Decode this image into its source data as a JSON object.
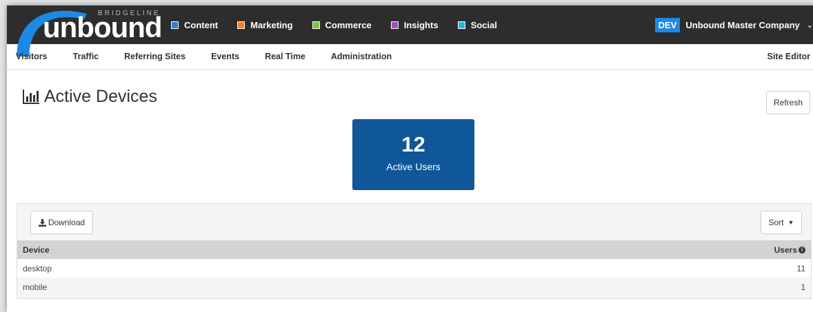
{
  "logo": {
    "word": "unbound",
    "tagline": "BRIDGELINE"
  },
  "modules": [
    {
      "label": "Content",
      "color": "#2f7fd6"
    },
    {
      "label": "Marketing",
      "color": "#f07f25"
    },
    {
      "label": "Commerce",
      "color": "#7ac143"
    },
    {
      "label": "Insights",
      "color": "#a04fb8"
    },
    {
      "label": "Social",
      "color": "#29b6d6"
    }
  ],
  "account": {
    "env_badge": "DEV",
    "company": "Unbound Master Company"
  },
  "subnav": {
    "items": [
      "Visitors",
      "Traffic",
      "Referring Sites",
      "Events",
      "Real Time",
      "Administration"
    ],
    "site_editor": "Site Editor"
  },
  "page": {
    "title": "Active Devices",
    "refresh_label": "Refresh"
  },
  "stat": {
    "value": "12",
    "label": "Active Users"
  },
  "panel": {
    "download_label": "Download",
    "sort_label": "Sort",
    "columns": {
      "device": "Device",
      "users": "Users"
    },
    "rows": [
      {
        "device": "desktop",
        "users": "11"
      },
      {
        "device": "mobile",
        "users": "1"
      }
    ]
  }
}
